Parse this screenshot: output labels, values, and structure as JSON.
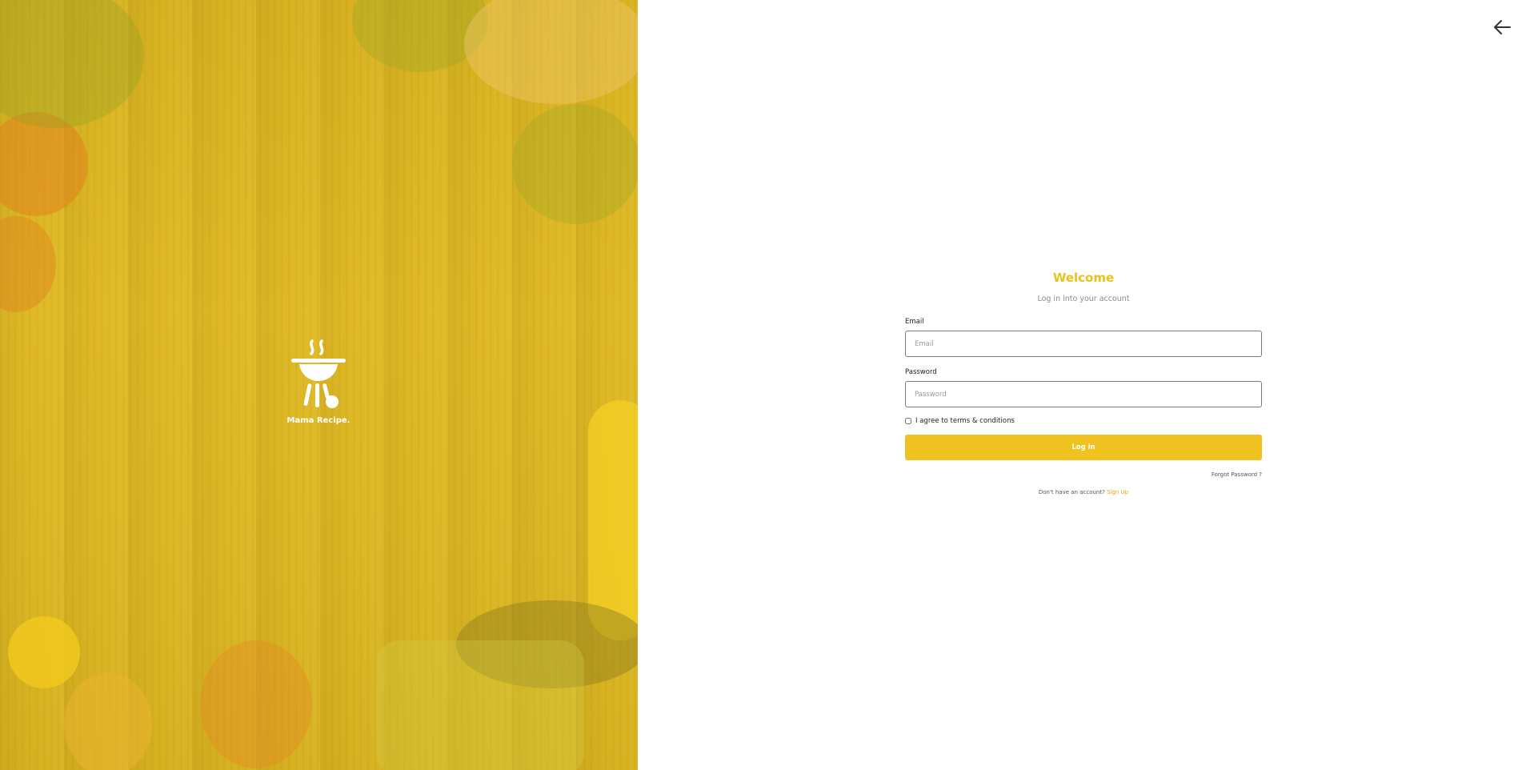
{
  "hero": {
    "logo_icon": "grill-icon",
    "logo_text": "Mama Recipe."
  },
  "header": {
    "back_icon": "arrow-left-icon"
  },
  "form": {
    "title": "Welcome",
    "subtitle": "Log in into your account",
    "email_label": "Email",
    "email_placeholder": "Email",
    "email_value": "",
    "password_label": "Password",
    "password_placeholder": "Password",
    "password_value": "",
    "agree_label": "I agree to terms & conditions",
    "agree_checked": false,
    "login_button": "Log in",
    "forgot_link": "Forgot Password ?",
    "signup_prompt": "Don't have an account?",
    "signup_link": "Sign Up"
  },
  "colors": {
    "accent": "#efc21f",
    "title": "#e8c21c",
    "link": "#e8a81c"
  }
}
